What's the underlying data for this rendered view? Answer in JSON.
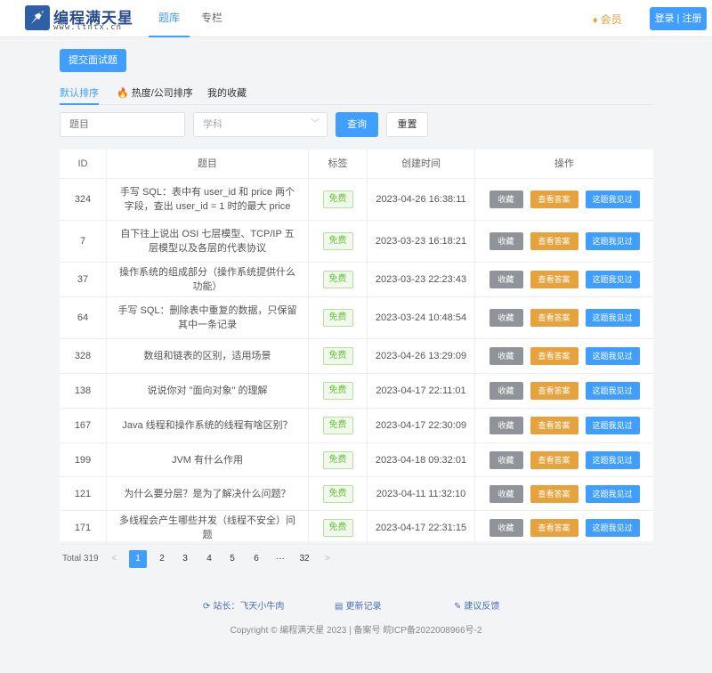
{
  "header": {
    "logo_title": "编程满天星",
    "logo_sub": "www.ltntx.cn",
    "nav": [
      "题库",
      "专栏"
    ],
    "vip": "会员",
    "login": "登录 | 注册"
  },
  "submit_label": "提交面试题",
  "sort_tabs": [
    "默认排序",
    "热度/公司排序",
    "我的收藏"
  ],
  "filters": {
    "title_placeholder": "题目",
    "subject_placeholder": "学科",
    "query": "查询",
    "reset": "重置"
  },
  "table": {
    "headers": [
      "ID",
      "题目",
      "标签",
      "创建时间",
      "操作"
    ],
    "ops": [
      "收藏",
      "查看答案",
      "这题我见过"
    ],
    "rows": [
      {
        "id": "324",
        "title": "手写 SQL：表中有 user_id 和 price 两个字段，查出 user_id = 1 时的最大 price",
        "tag": "免费",
        "time": "2023-04-26 16:38:11"
      },
      {
        "id": "7",
        "title": "自下往上说出 OSI 七层模型、TCP/IP 五层模型以及各层的代表协议",
        "tag": "免费",
        "time": "2023-03-23 16:18:21"
      },
      {
        "id": "37",
        "title": "操作系统的组成部分（操作系统提供什么功能）",
        "tag": "免费",
        "time": "2023-03-23 22:23:43"
      },
      {
        "id": "64",
        "title": "手写 SQL：删除表中重复的数据，只保留其中一条记录",
        "tag": "免费",
        "time": "2023-03-24 10:48:54"
      },
      {
        "id": "328",
        "title": "数组和链表的区别，适用场景",
        "tag": "免费",
        "time": "2023-04-26 13:29:09"
      },
      {
        "id": "138",
        "title": "说说你对 \"面向对象\" 的理解",
        "tag": "免费",
        "time": "2023-04-17 22:11:01"
      },
      {
        "id": "167",
        "title": "Java 线程和操作系统的线程有啥区别？",
        "tag": "免费",
        "time": "2023-04-17 22:30:09"
      },
      {
        "id": "199",
        "title": "JVM 有什么作用",
        "tag": "免费",
        "time": "2023-04-18 09:32:01"
      },
      {
        "id": "121",
        "title": "为什么要分层？是为了解决什么问题？",
        "tag": "免费",
        "time": "2023-04-11 11:32:10"
      },
      {
        "id": "171",
        "title": "多线程会产生哪些并发（线程不安全）问题",
        "tag": "免费",
        "time": "2023-04-17 22:31:15"
      }
    ]
  },
  "pagination": {
    "total": "Total 319",
    "prev": "<",
    "next": ">",
    "pages": [
      "1",
      "2",
      "3",
      "4",
      "5",
      "6",
      "···",
      "32"
    ],
    "current": "1"
  },
  "footer": {
    "links": [
      "站长：飞天小牛肉",
      "更新记录",
      "建议反馈"
    ],
    "copyright": "Copyright © 编程满天星 2023 | 备案号 皖ICP备2022008966号-2"
  },
  "colors": {
    "primary": "#409eff",
    "warning": "#e6a23c",
    "info": "#909399",
    "success": "#67c23a"
  }
}
